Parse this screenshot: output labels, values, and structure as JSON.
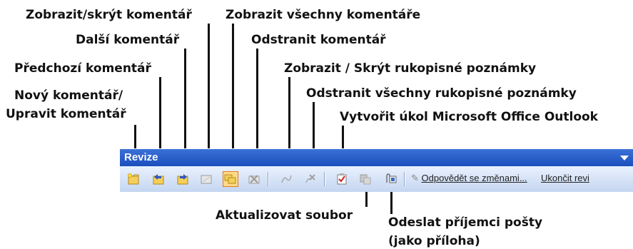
{
  "callouts": {
    "show_hide_comment": "Zobrazit/skrýt komentář",
    "show_all_comments": "Zobrazit všechny komentáře",
    "next_comment": "Další komentář",
    "delete_comment": "Odstranit komentář",
    "previous_comment": "Předchozí komentář",
    "show_hide_ink": "Zobrazit / Skrýt rukopisné poznámky",
    "new_comment_line1": "Nový komentář/",
    "new_comment_line2": "Upravit komentář",
    "delete_all_ink": "Odstranit všechny rukopisné poznámky",
    "create_outlook_task": "Vytvořit úkol Microsoft Office Outlook",
    "update_file": "Aktualizovat soubor",
    "send_to_mail_line1": "Odeslat příjemci pošty",
    "send_to_mail_line2": "(jako příloha)"
  },
  "toolbar": {
    "title": "Revize",
    "reply_with_changes": "Odpovědět se změnami...",
    "end_review": "Ukončit revi"
  },
  "colors": {
    "title_bar": "#2a62cc",
    "toolbar_bg": "#d6e3f6",
    "active_button": "#ffd98a"
  }
}
